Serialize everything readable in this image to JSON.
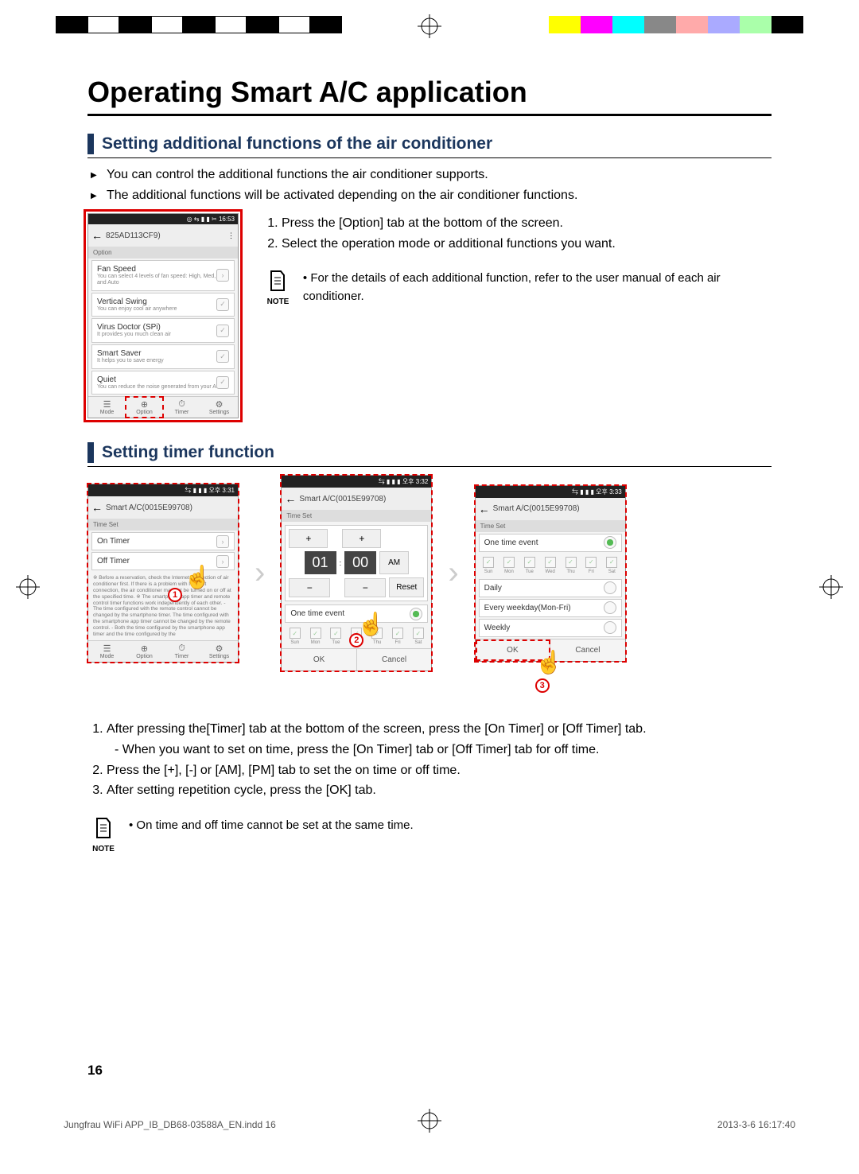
{
  "page_title": "Operating Smart A/C application",
  "section1": {
    "heading": "Setting additional functions of the air conditioner",
    "bullets": [
      "You can control the additional functions the air conditioner supports.",
      "The additional functions will be activated depending on the air conditioner functions."
    ],
    "steps": [
      "Press the [Option] tab at the bottom of the screen.",
      "Select the operation mode or additional functions you want."
    ],
    "note": "For the details of each additional function, refer to the user manual of each air conditioner.",
    "note_label": "NOTE"
  },
  "phone1": {
    "status_time": "16:53",
    "device_id": "825AD113CF9)",
    "screen_label": "Option",
    "options": [
      {
        "title": "Fan Speed",
        "desc": "You can select 4 levels of fan speed: High, Med, Low and Auto",
        "ctrl": ">"
      },
      {
        "title": "Vertical Swing",
        "desc": "You can enjoy cool air anywhere",
        "ctrl": "✓"
      },
      {
        "title": "Virus Doctor (SPi)",
        "desc": "It provides you much clean air",
        "ctrl": "✓"
      },
      {
        "title": "Smart Saver",
        "desc": "It helps you to save energy",
        "ctrl": "✓"
      },
      {
        "title": "Quiet",
        "desc": "You can reduce the noise generated from your AC",
        "ctrl": "✓"
      }
    ],
    "tabs": [
      "Mode",
      "Option",
      "Timer",
      "Settings"
    ]
  },
  "section2": {
    "heading": "Setting timer function",
    "steps": [
      {
        "text": "After pressing  the[Timer] tab at the bottom of the screen, press the [On Timer] or [Off Timer] tab.",
        "sub": "- When you want to set on time, press the [On Timer] tab or [Off Timer] tab for off time."
      },
      {
        "text": "Press the [+], [-] or [AM], [PM] tab to set the on time or off time."
      },
      {
        "text": "After setting repetition cycle, press the [OK] tab."
      }
    ],
    "note": "On time and off time cannot be set at the same time.",
    "note_label": "NOTE"
  },
  "phone_timer_hdr": {
    "status1": "오후 3:31",
    "status2": "오후 3:32",
    "status3": "오후 3:33",
    "title": "Smart A/C(0015E99708)",
    "screen_label": "Time Set"
  },
  "phone2": {
    "on_timer": "On Timer",
    "off_timer": "Off Timer",
    "note_text": "※ Before a reservation, check the Internet connection of air conditioner first. If there is a problem with Internet connection, the air conditioner may not be turned on or off at the specified time.\n※ The smartphone app timer and remote control timer functions work independently of each other.\n- The time configured with the remote control cannot be changed by the smartphone timer. The time configured with the smartphone app timer cannot be changed by the remote control.\n- Both the time configured by the smartphone app timer and the time configured by the",
    "tabs": [
      "Mode",
      "Option",
      "Timer",
      "Settings"
    ]
  },
  "phone3": {
    "hh": "01",
    "mm": "00",
    "ampm": "AM",
    "reset": "Reset",
    "one_time": "One time event",
    "days": [
      "Sun",
      "Mon",
      "Tue",
      "Wed",
      "Thu",
      "Fri",
      "Sat"
    ],
    "ok": "OK",
    "cancel": "Cancel"
  },
  "phone4": {
    "opts": [
      "One time event",
      "Daily",
      "Every weekday(Mon-Fri)",
      "Weekly"
    ],
    "days": [
      "Sun",
      "Mon",
      "Tue",
      "Wed",
      "Thu",
      "Fri",
      "Sat"
    ],
    "ok": "OK",
    "cancel": "Cancel"
  },
  "page_number": "16",
  "footer_left": "Jungfrau WiFi APP_IB_DB68-03588A_EN.indd   16",
  "footer_right": "2013-3-6   16:17:40"
}
